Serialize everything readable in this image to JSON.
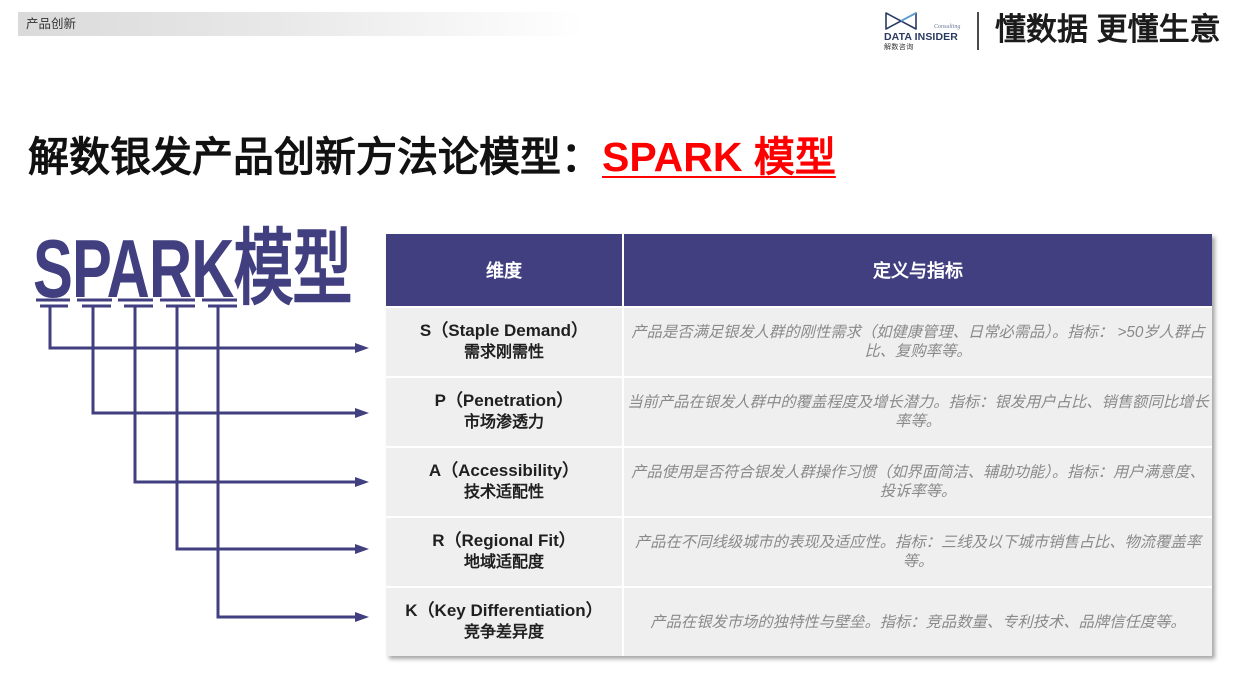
{
  "header": {
    "section_label": "产品创新",
    "logo": {
      "icon": "bowtie-logo-icon",
      "script": "Consulting",
      "name": "DATA INSIDER",
      "chinese_name": "解数咨询"
    },
    "slogan": "懂数据 更懂生意"
  },
  "title": {
    "main": "解数银发产品创新方法论模型：",
    "highlight": "SPARK 模型"
  },
  "model": {
    "name": "SPARK模型"
  },
  "table": {
    "headers": [
      "维度",
      "定义与指标"
    ],
    "rows": [
      {
        "dimension": "S（Staple Demand）",
        "dimension_cn": "需求刚需性",
        "definition": "产品是否满足银发人群的刚性需求（如健康管理、日常必需品）。指标： >50岁人群占比、复购率等。"
      },
      {
        "dimension": "P（Penetration）",
        "dimension_cn": "市场渗透力",
        "definition": "当前产品在银发人群中的覆盖程度及增长潜力。指标：银发用户占比、销售额同比增长率等。"
      },
      {
        "dimension": "A（Accessibility）",
        "dimension_cn": "技术适配性",
        "definition": "产品使用是否符合银发人群操作习惯（如界面简洁、辅助功能）。指标：用户满意度、投诉率等。"
      },
      {
        "dimension": "R（Regional Fit）",
        "dimension_cn": "地域适配度",
        "definition": "产品在不同线级城市的表现及适应性。指标：三线及以下城市销售占比、物流覆盖率等。"
      },
      {
        "dimension": "K（Key Differentiation）",
        "dimension_cn": "竞争差异度",
        "definition": "产品在银发市场的独特性与壁垒。指标：竞品数量、专利技术、品牌信任度等。"
      }
    ]
  },
  "colors": {
    "primary": "#413f80",
    "highlight_red": "#ff0000",
    "row_background": "#efefef",
    "definition_text": "#8a8a8a"
  }
}
